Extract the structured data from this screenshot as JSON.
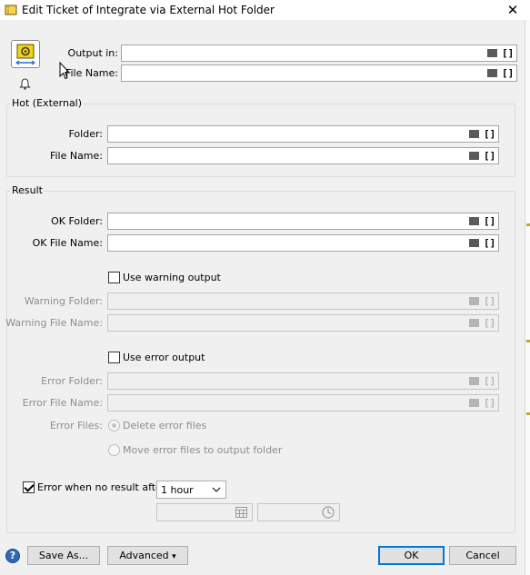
{
  "window": {
    "title": "Edit Ticket of Integrate via External Hot Folder",
    "close_glyph": "✕"
  },
  "top": {
    "output_in_label": "Output in:",
    "output_in_value": "",
    "file_name_label": "File Name:",
    "file_name_value": ""
  },
  "hot": {
    "title": "Hot (External)",
    "folder_label": "Folder:",
    "folder_value": "",
    "file_name_label": "File Name:",
    "file_name_value": ""
  },
  "result": {
    "title": "Result",
    "ok_folder_label": "OK Folder:",
    "ok_folder_value": "",
    "ok_file_name_label": "OK File Name:",
    "ok_file_name_value": "",
    "use_warning_label": "Use warning output",
    "use_warning_checked": false,
    "warning_folder_label": "Warning Folder:",
    "warning_file_name_label": "Warning File Name:",
    "use_error_label": "Use error output",
    "use_error_checked": false,
    "error_folder_label": "Error Folder:",
    "error_file_name_label": "Error File Name:",
    "error_files_label": "Error Files:",
    "delete_error_files_label": "Delete error files",
    "move_error_files_label": "Move error files to output folder",
    "error_when_no_result_label": "Error when no result after",
    "error_when_no_result_checked": true,
    "timeout_value": "1 hour",
    "date_value": "",
    "time_value": ""
  },
  "buttons": {
    "help_glyph": "?",
    "save_as": "Save As...",
    "advanced": "Advanced",
    "advanced_arrow": "▾",
    "ok": "OK",
    "cancel": "Cancel"
  },
  "icons": {
    "title_icon": "ticket-icon",
    "app_icon": "hot-folder-gear-icon",
    "bell_icon": "bell-icon",
    "folder_icon": "folder-icon",
    "variable_icon": "variable-bracket-icon",
    "calendar_icon": "calendar-icon",
    "clock_icon": "clock-icon",
    "help_icon": "help-icon"
  },
  "colors": {
    "accent": "#0078d7",
    "app_icon_yellow": "#f3d21c",
    "help_blue": "#2f67b5"
  }
}
